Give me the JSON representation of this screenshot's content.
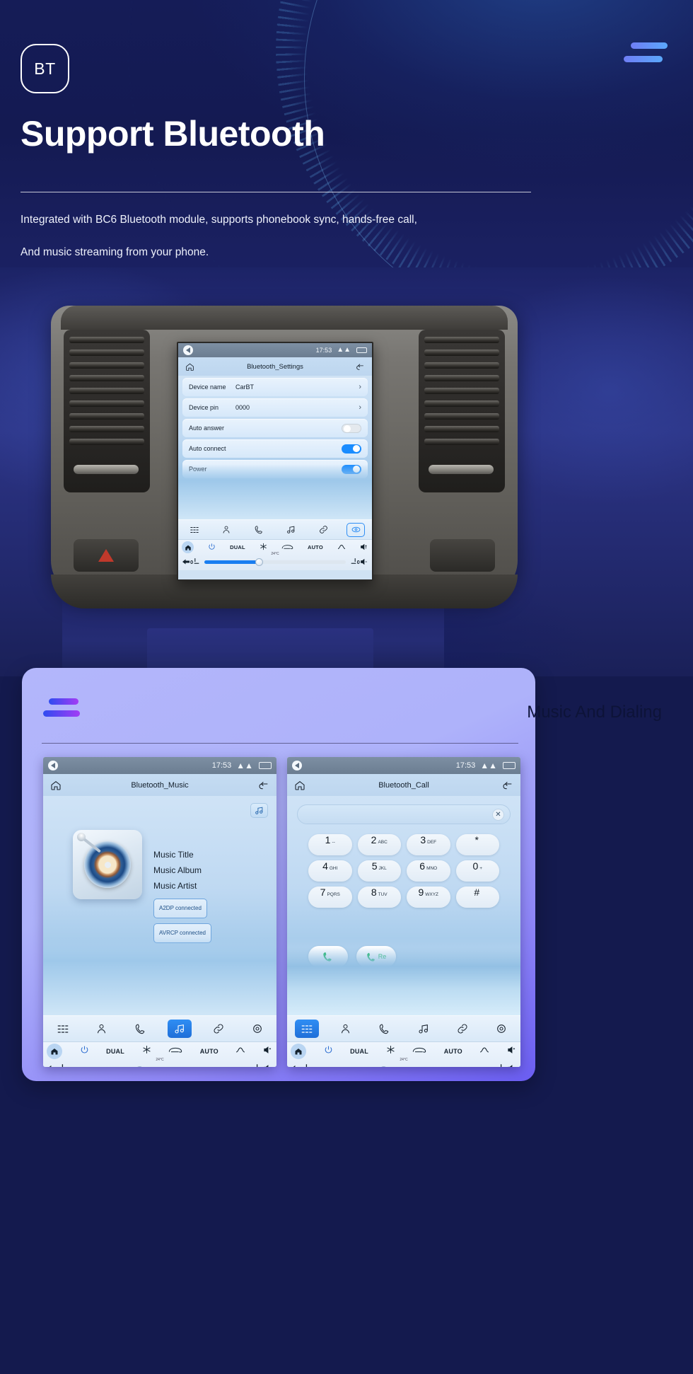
{
  "hero": {
    "badge_text": "BT",
    "title": "Support Bluetooth",
    "desc_line1": "Integrated with BC6 Bluetooth module, supports phonebook sync, hands-free call,",
    "desc_line2": "And music streaming from your phone.",
    "menu_icon": "hamburger-icon"
  },
  "colors": {
    "hero_bg": "#141a52",
    "card_bg_start": "#b3b6fb",
    "card_bg_end": "#6b5ef2",
    "accent_blue": "#1a8cff",
    "bar_gradient_start": "#2f4cf0",
    "bar_gradient_end": "#a33cf5",
    "call_green": "#18b85f"
  },
  "settings_screen": {
    "status": {
      "time": "17:53",
      "chevron": "chevron-up-icon",
      "battery": "battery-icon",
      "back": "back-icon"
    },
    "title": "Bluetooth_Settings",
    "home_icon": "home-icon",
    "return_icon": "return-icon",
    "rows": [
      {
        "label": "Device name",
        "value": "CarBT",
        "control": "arrow",
        "arrow": "›"
      },
      {
        "label": "Device pin",
        "value": "0000",
        "control": "arrow",
        "arrow": "›"
      },
      {
        "label": "Auto answer",
        "value": "",
        "control": "toggle",
        "state": "off"
      },
      {
        "label": "Auto connect",
        "value": "",
        "control": "toggle",
        "state": "on"
      },
      {
        "label": "Power",
        "value": "",
        "control": "toggle",
        "state": "on"
      }
    ],
    "dock": [
      {
        "icon": "apps-grid-icon",
        "active": false
      },
      {
        "icon": "contact-icon",
        "active": false
      },
      {
        "icon": "phone-icon",
        "active": false
      },
      {
        "icon": "music-note-icon",
        "active": false
      },
      {
        "icon": "link-icon",
        "active": false
      },
      {
        "icon": "bluetooth-settings-icon",
        "active": true
      }
    ],
    "climate": {
      "home": "home-icon",
      "power": "power-icon",
      "dual": "DUAL",
      "snowflake": "snowflake-icon",
      "defrost": "defrost-rear-icon",
      "auto": "AUTO",
      "airflow": "airflow-icon",
      "volume": "volume-up-icon",
      "temp_unit": "24°C",
      "left_level": "0",
      "right_level": "0",
      "seat_left": "seat-icon",
      "seat_right": "seat-heater-icon",
      "back": "back-arrow-icon",
      "volume_down": "volume-down-icon"
    }
  },
  "card": {
    "title": "Music And Dialing",
    "bars_icon": "menu-bars-icon"
  },
  "music_screen": {
    "status": {
      "time": "17:53",
      "chevron": "chevron-up-icon",
      "battery": "battery-icon",
      "back": "back-icon"
    },
    "title": "Bluetooth_Music",
    "home_icon": "home-icon",
    "return_icon": "return-icon",
    "note_button": "music-note-icon",
    "album_art": "vinyl-record-icon",
    "meta": {
      "title": "Music Title",
      "album": "Music Album",
      "artist": "Music Artist"
    },
    "badges": [
      "A2DP  connected",
      "AVRCP  connected"
    ],
    "transport": [
      {
        "icon": "previous-track-icon"
      },
      {
        "icon": "play-icon"
      },
      {
        "icon": "next-track-icon"
      }
    ],
    "dock": [
      {
        "icon": "apps-grid-icon",
        "active": false
      },
      {
        "icon": "contact-icon",
        "active": false
      },
      {
        "icon": "phone-icon",
        "active": false
      },
      {
        "icon": "music-note-icon",
        "active": true
      },
      {
        "icon": "link-icon",
        "active": false
      },
      {
        "icon": "settings-gear-icon",
        "active": false
      }
    ]
  },
  "call_screen": {
    "status": {
      "time": "17:53",
      "chevron": "chevron-up-icon",
      "battery": "battery-icon",
      "back": "back-icon"
    },
    "title": "Bluetooth_Call",
    "home_icon": "home-icon",
    "return_icon": "return-icon",
    "number_value": "",
    "clear_icon": "close-icon",
    "keys": [
      {
        "num": "1",
        "sub": "--"
      },
      {
        "num": "2",
        "sub": "ABC"
      },
      {
        "num": "3",
        "sub": "DEF"
      },
      {
        "num": "*",
        "sub": ""
      },
      {
        "num": "4",
        "sub": "GHI"
      },
      {
        "num": "5",
        "sub": "JKL"
      },
      {
        "num": "6",
        "sub": "MNO"
      },
      {
        "num": "0",
        "sub": "+"
      },
      {
        "num": "7",
        "sub": "PQRS"
      },
      {
        "num": "8",
        "sub": "TUV"
      },
      {
        "num": "9",
        "sub": "WXYZ"
      },
      {
        "num": "#",
        "sub": ""
      }
    ],
    "call_button": "phone-call-icon",
    "redial_label": "Re",
    "dock": [
      {
        "icon": "apps-grid-icon",
        "active": true
      },
      {
        "icon": "contact-icon",
        "active": false
      },
      {
        "icon": "phone-icon",
        "active": false
      },
      {
        "icon": "music-note-icon",
        "active": false
      },
      {
        "icon": "link-icon",
        "active": false
      },
      {
        "icon": "settings-gear-icon",
        "active": false
      }
    ]
  },
  "climate_shared": {
    "dual": "DUAL",
    "auto": "AUTO",
    "temp_unit": "24°C",
    "left_level": "0",
    "right_level": "0"
  }
}
